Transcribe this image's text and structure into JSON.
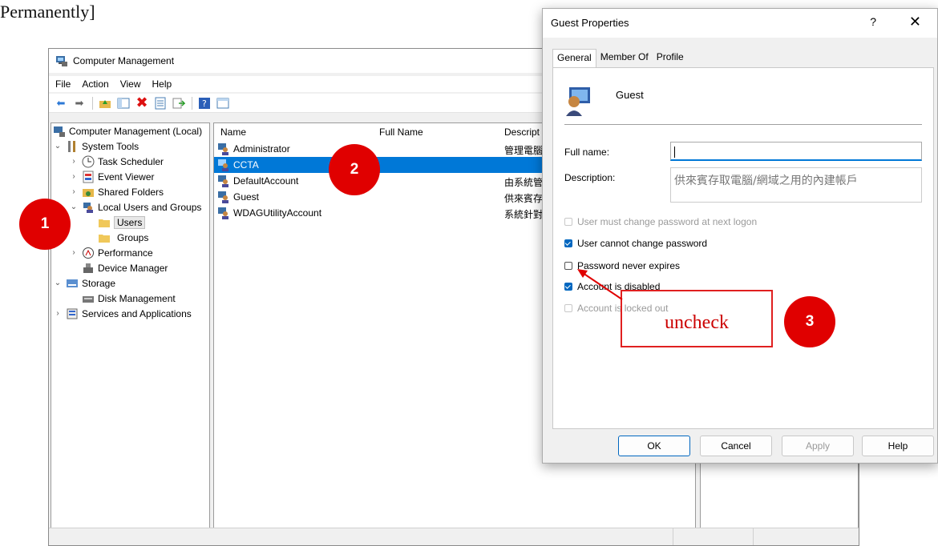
{
  "page": {
    "heading_fragment": "Permanently]"
  },
  "cm": {
    "title": "Computer Management",
    "menu": [
      "File",
      "Action",
      "View",
      "Help"
    ],
    "tree": [
      "Computer Management (Local)",
      "System Tools",
      "Task Scheduler",
      "Event Viewer",
      "Shared Folders",
      "Local Users and Groups",
      "Users",
      "Groups",
      "Performance",
      "Device Manager",
      "Storage",
      "Disk Management",
      "Services and Applications"
    ],
    "columns": {
      "name": "Name",
      "full_name": "Full Name",
      "description": "Descript"
    },
    "users": [
      {
        "name": "Administrator",
        "desc": "管理電腦"
      },
      {
        "name": "CCTA",
        "desc": ""
      },
      {
        "name": "DefaultAccount",
        "desc": "由系統管"
      },
      {
        "name": "Guest",
        "desc": "供來賓存"
      },
      {
        "name": "WDAGUtilityAccount",
        "desc": "系統針對"
      }
    ]
  },
  "dialog": {
    "title": "Guest Properties",
    "help_glyph": "?",
    "close_glyph": "✕",
    "tabs": [
      "General",
      "Member Of",
      "Profile"
    ],
    "user_name": "Guest",
    "full_name_label": "Full name:",
    "full_name_value": "",
    "description_label": "Description:",
    "description_value": "供來賓存取電腦/網域之用的內建帳戶",
    "checks": [
      {
        "label": "User must change password at next logon",
        "checked": false,
        "disabled": true
      },
      {
        "label": "User cannot change password",
        "checked": true,
        "disabled": false
      },
      {
        "label": "Password never expires",
        "checked": false,
        "disabled": false
      },
      {
        "label": "Account is disabled",
        "checked": true,
        "disabled": false
      },
      {
        "label": "Account is locked out",
        "checked": false,
        "disabled": true
      }
    ],
    "buttons": {
      "ok": "OK",
      "cancel": "Cancel",
      "apply": "Apply",
      "help": "Help"
    }
  },
  "annotations": {
    "badge1": "1",
    "badge2": "2",
    "badge3": "3",
    "note": "uncheck",
    "accent_color": "#e00000"
  }
}
